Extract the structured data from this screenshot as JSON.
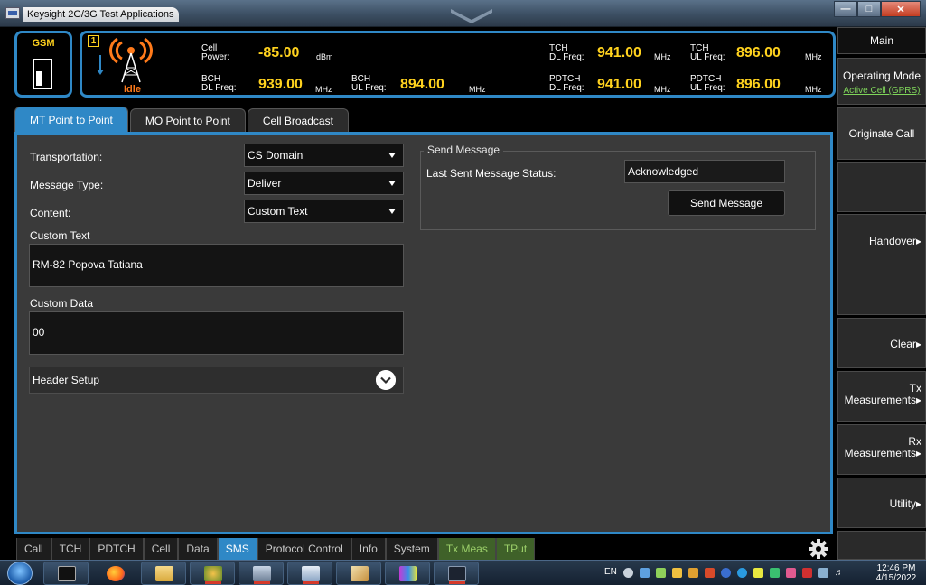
{
  "window": {
    "title": "Keysight 2G/3G Test Applications"
  },
  "header": {
    "format": "GSM",
    "cell_number": "1",
    "cell_state": "Idle",
    "cell_power": {
      "label_1": "Cell",
      "label_2": "Power:",
      "value": "-85.00",
      "unit": "dBm"
    },
    "bch_dl": {
      "label_1": "BCH",
      "label_2": "DL Freq:",
      "value": "939.00",
      "unit": "MHz"
    },
    "bch_ul": {
      "label_1": "BCH",
      "label_2": "UL Freq:",
      "value": "894.00",
      "unit": "MHz"
    },
    "tch_dl": {
      "label_1": "TCH",
      "label_2": "DL Freq:",
      "value": "941.00",
      "unit": "MHz"
    },
    "tch_ul": {
      "label_1": "TCH",
      "label_2": "UL Freq:",
      "value": "896.00",
      "unit": "MHz"
    },
    "pdtch_dl": {
      "label_1": "PDTCH",
      "label_2": "DL Freq:",
      "value": "941.00",
      "unit": "MHz"
    },
    "pdtch_ul": {
      "label_1": "PDTCH",
      "label_2": "UL Freq:",
      "value": "896.00",
      "unit": "MHz"
    }
  },
  "tabs": [
    {
      "label": "MT Point to Point",
      "active": true
    },
    {
      "label": "MO Point to Point",
      "active": false
    },
    {
      "label": "Cell Broadcast",
      "active": false
    }
  ],
  "form": {
    "transportation": {
      "label": "Transportation:",
      "value": "CS Domain"
    },
    "message_type": {
      "label": "Message Type:",
      "value": "Deliver"
    },
    "content": {
      "label": "Content:",
      "value": "Custom Text"
    },
    "custom_text": {
      "label": "Custom Text",
      "value": "RM-82 Popova Tatiana"
    },
    "custom_data": {
      "label": "Custom Data",
      "value": "00"
    },
    "header_setup": {
      "label": "Header Setup"
    }
  },
  "send_message": {
    "group_label": "Send Message",
    "status_label": "Last Sent Message Status:",
    "status_value": "Acknowledged",
    "button_label": "Send Message"
  },
  "softkeys": {
    "main": "Main",
    "operating_mode": "Operating Mode",
    "operating_mode_value": "Active Cell (GPRS)",
    "originate_call": "Originate Call",
    "handover": "Handover▸",
    "clear": "Clear▸",
    "tx_1": "Tx",
    "tx_2": "Measurements▸",
    "rx_1": "Rx",
    "rx_2": "Measurements▸",
    "utility": "Utility▸"
  },
  "bottom_tabs": [
    {
      "label": "Call",
      "state": "normal"
    },
    {
      "label": "TCH",
      "state": "normal"
    },
    {
      "label": "PDTCH",
      "state": "normal"
    },
    {
      "label": "Cell",
      "state": "normal"
    },
    {
      "label": "Data",
      "state": "normal"
    },
    {
      "label": "SMS",
      "state": "active"
    },
    {
      "label": "Protocol Control",
      "state": "normal"
    },
    {
      "label": "Info",
      "state": "normal"
    },
    {
      "label": "System",
      "state": "normal"
    },
    {
      "label": "Tx Meas",
      "state": "green"
    },
    {
      "label": "TPut",
      "state": "green"
    }
  ],
  "taskbar": {
    "language": "EN",
    "time": "12:46 PM",
    "date": "4/15/2022",
    "apps": [
      "cmd-icon",
      "firefox-icon",
      "file-explorer-icon",
      "app-icon-1",
      "app-icon-2",
      "app-icon-3",
      "paint-icon",
      "app-icon-4",
      "app-icon-5"
    ]
  },
  "colors": {
    "accent_blue": "#2f88c6",
    "value_yellow": "#ffd21e",
    "idle_orange": "#ff7a1a",
    "link_green": "#7fd55a",
    "tab_green_text": "#9cd06a"
  }
}
